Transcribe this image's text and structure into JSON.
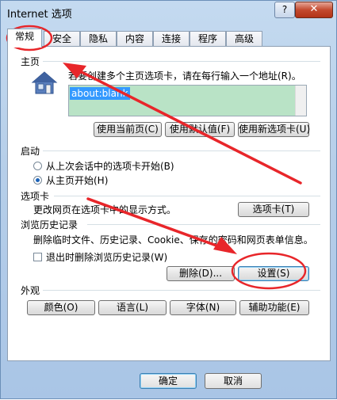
{
  "window": {
    "title": "Internet 选项",
    "help": "?",
    "close": "✕"
  },
  "tabs": [
    "常规",
    "安全",
    "隐私",
    "内容",
    "连接",
    "程序",
    "高级"
  ],
  "homepage": {
    "section": "主页",
    "description": "若要创建多个主页选项卡，请在每行输入一个地址(R)。",
    "value": "about:blank",
    "buttons": {
      "use_current": "使用当前页(C)",
      "use_default": "使用默认值(F)",
      "use_new_tab": "使用新选项卡(U)"
    }
  },
  "startup": {
    "section": "启动",
    "option_last_session": "从上次会话中的选项卡开始(B)",
    "option_homepage": "从主页开始(H)"
  },
  "tabs_section": {
    "section": "选项卡",
    "description": "更改网页在选项卡中的显示方式。",
    "button": "选项卡(T)"
  },
  "history": {
    "section": "浏览历史记录",
    "description": "删除临时文件、历史记录、Cookie、保存的密码和网页表单信息。",
    "checkbox_label": "退出时删除浏览历史记录(W)",
    "delete_button": "删除(D)...",
    "settings_button": "设置(S)"
  },
  "appearance": {
    "section": "外观",
    "buttons": {
      "colors": "颜色(O)",
      "languages": "语言(L)",
      "fonts": "字体(N)",
      "accessibility": "辅助功能(E)"
    }
  },
  "footer": {
    "ok": "确定",
    "cancel": "取消"
  },
  "colors": {
    "annotation": "#e8262a",
    "selection": "#3399ff",
    "input_bg": "#b9e3c6"
  }
}
